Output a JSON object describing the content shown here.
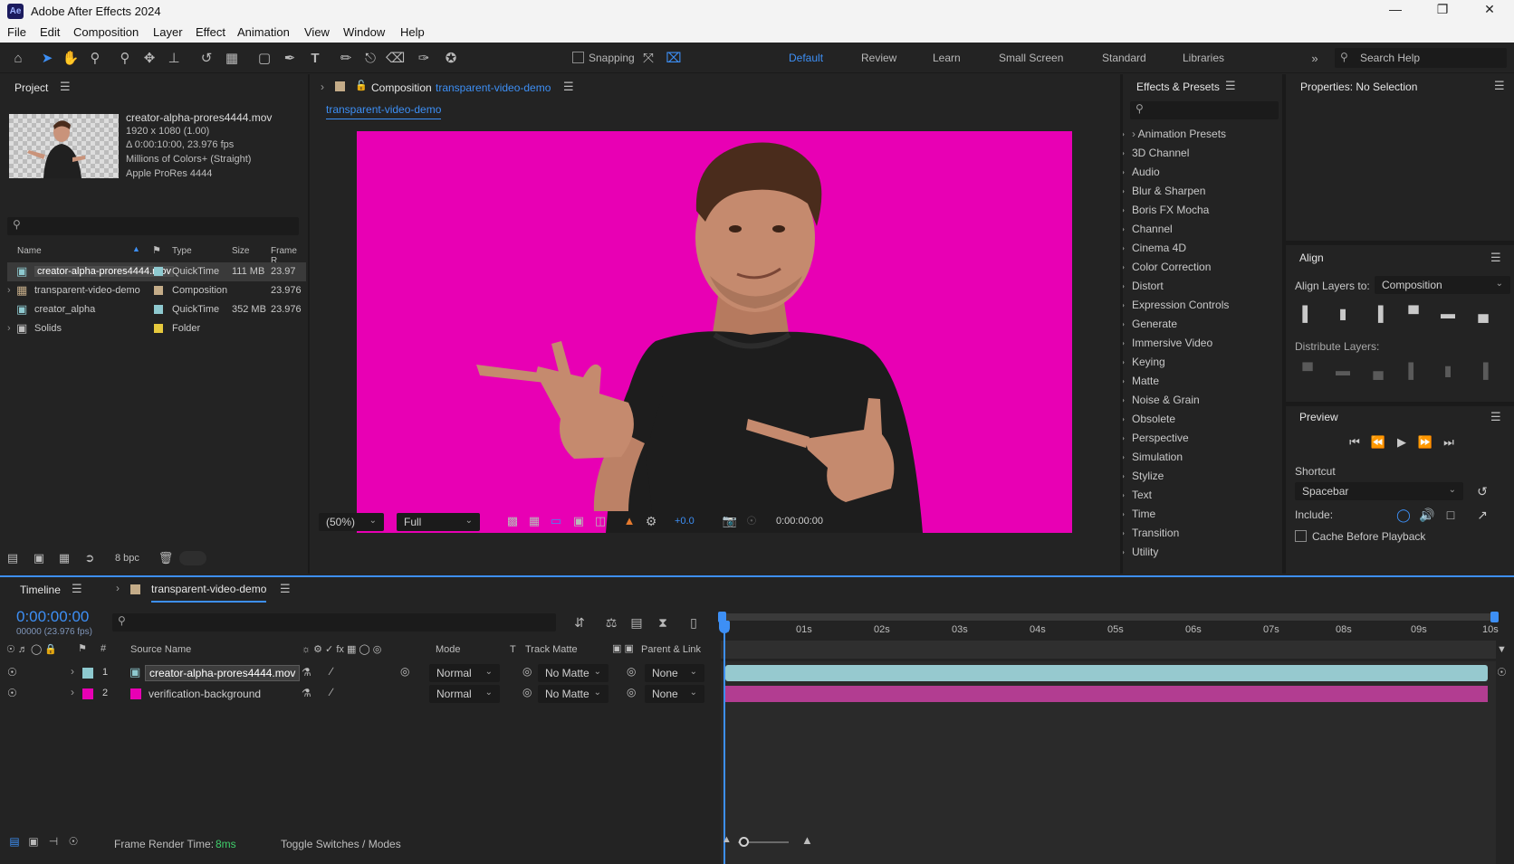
{
  "app": {
    "title": "Adobe After Effects 2024",
    "logo": "Ae"
  },
  "menu": [
    "File",
    "Edit",
    "Composition",
    "Layer",
    "Effect",
    "Animation",
    "View",
    "Window",
    "Help"
  ],
  "toolbar": {
    "snapping_label": "Snapping",
    "workspaces": [
      "Default",
      "Review",
      "Learn",
      "Small Screen",
      "Standard",
      "Libraries"
    ],
    "active_workspace": "Default",
    "search_placeholder": "Search Help"
  },
  "project": {
    "title": "Project",
    "selected_item": {
      "name": "creator-alpha-prores4444.mov",
      "resolution": "1920 x 1080 (1.00)",
      "duration": "Δ 0:00:10:00, 23.976 fps",
      "colors": "Millions of Colors+ (Straight)",
      "codec": "Apple ProRes 4444"
    },
    "columns": [
      "Name",
      "Type",
      "Size",
      "Frame R."
    ],
    "items": [
      {
        "name": "creator-alpha-prores4444.mov",
        "type": "QuickTime",
        "size": "111 MB",
        "fps": "23.97",
        "color": "#8ec9cf"
      },
      {
        "name": "transparent-video-demo",
        "type": "Composition",
        "size": "",
        "fps": "23.976",
        "color": "#c4ac88"
      },
      {
        "name": "creator_alpha",
        "type": "QuickTime",
        "size": "352 MB",
        "fps": "23.976",
        "color": "#8ec9cf"
      },
      {
        "name": "Solids",
        "type": "Folder",
        "size": "",
        "fps": "",
        "color": "#e6c93d"
      }
    ],
    "bpc": "8 bpc"
  },
  "composition": {
    "header_label": "Composition",
    "name": "transparent-video-demo",
    "tab": "transparent-video-demo",
    "background": "#e800b4",
    "zoom": "(50%)",
    "quality": "Full",
    "exposure": "+0.0",
    "timecode": "0:00:00:00"
  },
  "effects": {
    "title": "Effects & Presets",
    "items": [
      "Animation Presets",
      "3D Channel",
      "Audio",
      "Blur & Sharpen",
      "Boris FX Mocha",
      "Channel",
      "Cinema 4D",
      "Color Correction",
      "Distort",
      "Expression Controls",
      "Generate",
      "Immersive Video",
      "Keying",
      "Matte",
      "Noise & Grain",
      "Obsolete",
      "Perspective",
      "Simulation",
      "Stylize",
      "Text",
      "Time",
      "Transition",
      "Utility"
    ]
  },
  "properties": {
    "title": "Properties: No Selection"
  },
  "align": {
    "title": "Align",
    "align_to_label": "Align Layers to:",
    "align_to_value": "Composition",
    "distribute_label": "Distribute Layers:"
  },
  "preview": {
    "title": "Preview",
    "shortcut_label": "Shortcut",
    "shortcut_value": "Spacebar",
    "include_label": "Include:",
    "cache_label": "Cache Before Playback"
  },
  "timeline": {
    "title": "Timeline",
    "comp_tab": "transparent-video-demo",
    "timecode": "0:00:00:00",
    "frames": "00000 (23.976 fps)",
    "columns": {
      "source": "Source Name",
      "mode": "Mode",
      "t": "T",
      "track_matte": "Track Matte",
      "parent": "Parent & Link"
    },
    "layers": [
      {
        "num": "1",
        "name": "creator-alpha-prores4444.mov",
        "mode": "Normal",
        "matte": "No Matte",
        "parent": "None",
        "color": "#8ec9cf",
        "bar": "#96c9cf"
      },
      {
        "num": "2",
        "name": "verification-background",
        "mode": "Normal",
        "matte": "No Matte",
        "parent": "None",
        "color": "#e800b4",
        "bar": "#b23d91"
      }
    ],
    "ticks": [
      "01s",
      "02s",
      "03s",
      "04s",
      "05s",
      "06s",
      "07s",
      "08s",
      "09s",
      "10s"
    ],
    "render_time_label": "Frame Render Time:",
    "render_time_value": "8ms",
    "toggle_label": "Toggle Switches / Modes"
  }
}
